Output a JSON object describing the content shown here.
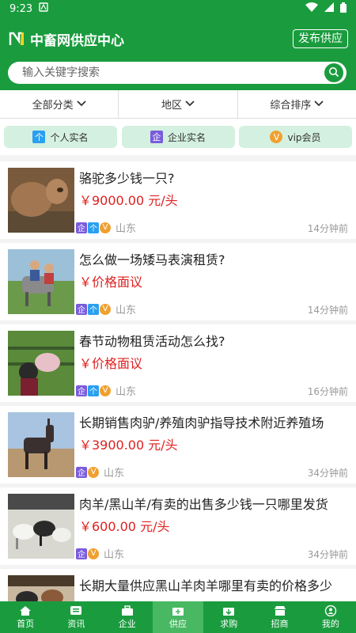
{
  "status_bar": {
    "time": "9:23"
  },
  "header": {
    "title": "中畜网供应中心",
    "publish_label": "发布供应"
  },
  "search": {
    "placeholder": "输入关键字搜索"
  },
  "filters": [
    {
      "label": "全部分类"
    },
    {
      "label": "地区"
    },
    {
      "label": "综合排序"
    }
  ],
  "tags": [
    {
      "icon_text": "个",
      "label": "个人实名",
      "color": "#2aa0f0"
    },
    {
      "icon_text": "企",
      "label": "企业实名",
      "color": "#7a5bdc"
    },
    {
      "icon_text": "V",
      "label": "vip会员",
      "color": "#f0a030"
    }
  ],
  "listings": [
    {
      "title": "骆驼多少钱一只?",
      "price": "￥9000.00 元/头",
      "region": "山东",
      "time": "14分钟前"
    },
    {
      "title": "怎么做一场矮马表演租赁?",
      "price": "￥价格面议",
      "region": "山东",
      "time": "14分钟前"
    },
    {
      "title": "春节动物租赁活动怎么找?",
      "price": "￥价格面议",
      "region": "山东",
      "time": "16分钟前"
    },
    {
      "title": "长期销售肉驴/养殖肉驴指导技术附近养殖场",
      "price": "￥3900.00 元/头",
      "region": "山东",
      "time": "34分钟前"
    },
    {
      "title": "肉羊/黑山羊/有卖的出售多少钱一只哪里发货",
      "price": "￥600.00 元/头",
      "region": "山东",
      "time": "34分钟前"
    },
    {
      "title": "长期大量供应黑山羊肉羊哪里有卖的价格多少",
      "price": "",
      "region": "",
      "time": ""
    }
  ],
  "tabs": [
    {
      "label": "首页"
    },
    {
      "label": "资讯"
    },
    {
      "label": "企业"
    },
    {
      "label": "供应"
    },
    {
      "label": "求购"
    },
    {
      "label": "招商"
    },
    {
      "label": "我的"
    }
  ],
  "colors": {
    "brand": "#1a9c3e",
    "price": "#e02020",
    "tag_bg": "#d4f0e0"
  }
}
